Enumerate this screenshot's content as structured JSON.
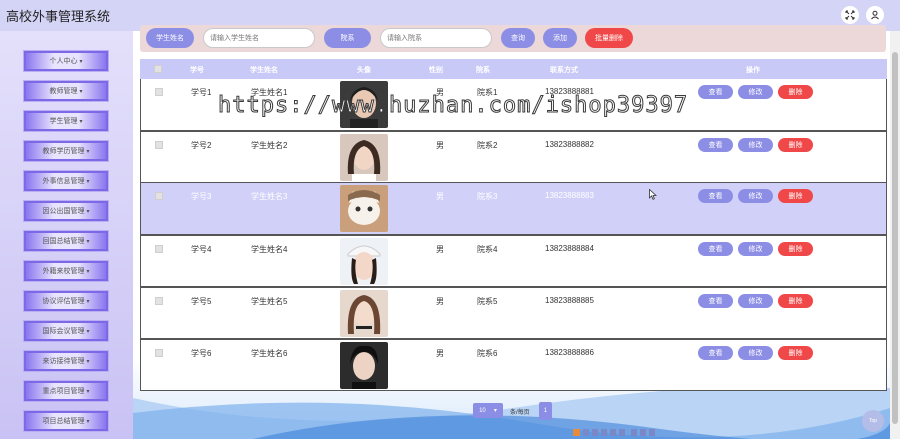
{
  "header": {
    "title": "高校外事管理系统",
    "icons": [
      "fullscreen-icon",
      "user-icon"
    ]
  },
  "sidebar": {
    "items": [
      {
        "label": "个人中心"
      },
      {
        "label": "教师管理"
      },
      {
        "label": "学生管理"
      },
      {
        "label": "教师学历管理"
      },
      {
        "label": "外事信息管理"
      },
      {
        "label": "因公出国管理"
      },
      {
        "label": "回国总结管理"
      },
      {
        "label": "外籍来校管理"
      },
      {
        "label": "协议评估管理"
      },
      {
        "label": "国际会议管理"
      },
      {
        "label": "来访接待管理"
      },
      {
        "label": "重点项目管理"
      },
      {
        "label": "项目总结管理"
      }
    ],
    "caret": "▾"
  },
  "search": {
    "student_name_label": "学生姓名",
    "student_name_placeholder": "请输入学生姓名",
    "department_label": "院系",
    "department_placeholder": "请输入院系",
    "query_label": "查询",
    "add_label": "添加",
    "batch_delete_label": "批量删除"
  },
  "table": {
    "headers": [
      "学号",
      "学生姓名",
      "头像",
      "性别",
      "院系",
      "联系方式",
      "操作"
    ],
    "rows": [
      {
        "id": "学号1",
        "name": "学生姓名1",
        "gender": "男",
        "dept": "院系1",
        "phone": "13823888881"
      },
      {
        "id": "学号2",
        "name": "学生姓名2",
        "gender": "男",
        "dept": "院系2",
        "phone": "13823888882"
      },
      {
        "id": "学号3",
        "name": "学生姓名3",
        "gender": "男",
        "dept": "院系3",
        "phone": "13823888883"
      },
      {
        "id": "学号4",
        "name": "学生姓名4",
        "gender": "男",
        "dept": "院系4",
        "phone": "13823888884"
      },
      {
        "id": "学号5",
        "name": "学生姓名5",
        "gender": "男",
        "dept": "院系5",
        "phone": "13823888885"
      },
      {
        "id": "学号6",
        "name": "学生姓名6",
        "gender": "男",
        "dept": "院系6",
        "phone": "13823888886"
      }
    ],
    "actions": {
      "view": "查看",
      "edit": "修改",
      "delete": "删除"
    },
    "highlighted_row": 3
  },
  "pagination": {
    "page_size": "10",
    "per_page_text": "条/每页",
    "current_page": "1"
  },
  "back_to_top": "Top",
  "watermark": "https://www.huzhan.com/ishop39397",
  "colors": {
    "header_bg": "#d4d4f7",
    "accent_purple": "#8c8ee6",
    "danger_red": "#f04848",
    "row_highlight": "#d0d0f9",
    "search_bar_bg": "#ecd8d8"
  }
}
